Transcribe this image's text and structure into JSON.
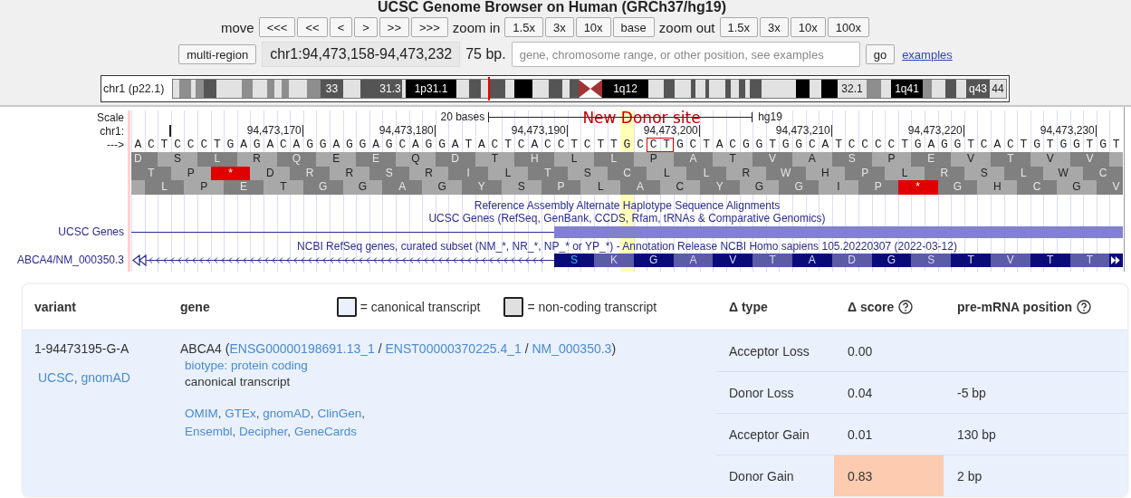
{
  "browser": {
    "title": "UCSC Genome Browser on Human (GRCh37/hg19)",
    "move": {
      "label": "move",
      "buttons": [
        "<<<",
        "<<",
        "<",
        ">",
        ">>",
        ">>>"
      ]
    },
    "zoom_in": {
      "label": "zoom in",
      "buttons": [
        "1.5x",
        "3x",
        "10x",
        "base"
      ]
    },
    "zoom_out": {
      "label": "zoom out",
      "buttons": [
        "1.5x",
        "3x",
        "10x",
        "100x"
      ]
    },
    "multi_region_button": "multi-region",
    "position": "chr1:94,473,158-94,473,232",
    "size": "75 bp.",
    "search": {
      "placeholder": "gene, chromosome range, or other position, see examples"
    },
    "go_button": "go",
    "examples_link": "examples",
    "ideogram": {
      "label": "chr1 (p22.1)",
      "band_labels": [
        "33",
        "31.3",
        "1p31.1",
        "1q12",
        "32.1",
        "1q41",
        "q43",
        "44"
      ]
    }
  },
  "tracks": {
    "scale": {
      "label": "Scale",
      "span": "20 bases",
      "assembly": "hg19"
    },
    "ruler": {
      "label": "chr1:",
      "ticks": [
        "94,473,170",
        "94,473,180",
        "94,473,190",
        "94,473,200",
        "94,473,210",
        "94,473,220",
        "94,473,230"
      ]
    },
    "strand": "--->",
    "annotation": "New Donor site",
    "sequence": [
      {
        "bases": "ACTCCCTGAGACAGGAGGAGCAGGATACTCACCTCTT",
        "kind": "plain"
      },
      {
        "bases": "G",
        "kind": "highlight"
      },
      {
        "bases": "C",
        "kind": "plain"
      },
      {
        "bases": "CT",
        "kind": "boxed"
      },
      {
        "bases": "GCTACGGTGGCATCCCCTGAGGTCACTGTGGTGT",
        "kind": "plain"
      }
    ],
    "frames": [
      {
        "residues": [
          {
            "aa": "D",
            "stop": false
          },
          {
            "aa": "S",
            "stop": false
          },
          {
            "aa": "L",
            "stop": false
          },
          {
            "aa": "R",
            "stop": false
          },
          {
            "aa": "Q",
            "stop": false
          },
          {
            "aa": "E",
            "stop": false
          },
          {
            "aa": "E",
            "stop": false
          },
          {
            "aa": "Q",
            "stop": false
          },
          {
            "aa": "D",
            "stop": false
          },
          {
            "aa": "T",
            "stop": false
          },
          {
            "aa": "H",
            "stop": false
          },
          {
            "aa": "L",
            "stop": false
          },
          {
            "aa": "L",
            "stop": false
          },
          {
            "aa": "P",
            "stop": false
          },
          {
            "aa": "A",
            "stop": false
          },
          {
            "aa": "T",
            "stop": false
          },
          {
            "aa": "V",
            "stop": false
          },
          {
            "aa": "A",
            "stop": false
          },
          {
            "aa": "S",
            "stop": false
          },
          {
            "aa": "P",
            "stop": false
          },
          {
            "aa": "E",
            "stop": false
          },
          {
            "aa": "V",
            "stop": false
          },
          {
            "aa": "T",
            "stop": false
          },
          {
            "aa": "V",
            "stop": false
          },
          {
            "aa": "V",
            "stop": false
          }
        ]
      },
      {
        "residues": [
          {
            "aa": "T",
            "stop": false
          },
          {
            "aa": "P",
            "stop": false
          },
          {
            "aa": "*",
            "stop": true
          },
          {
            "aa": "D",
            "stop": false
          },
          {
            "aa": "R",
            "stop": false
          },
          {
            "aa": "R",
            "stop": false
          },
          {
            "aa": "S",
            "stop": false
          },
          {
            "aa": "R",
            "stop": false
          },
          {
            "aa": "I",
            "stop": false
          },
          {
            "aa": "L",
            "stop": false
          },
          {
            "aa": "T",
            "stop": false
          },
          {
            "aa": "S",
            "stop": false
          },
          {
            "aa": "C",
            "stop": false
          },
          {
            "aa": "L",
            "stop": false
          },
          {
            "aa": "L",
            "stop": false
          },
          {
            "aa": "R",
            "stop": false
          },
          {
            "aa": "W",
            "stop": false
          },
          {
            "aa": "H",
            "stop": false
          },
          {
            "aa": "P",
            "stop": false
          },
          {
            "aa": "L",
            "stop": false
          },
          {
            "aa": "R",
            "stop": false
          },
          {
            "aa": "S",
            "stop": false
          },
          {
            "aa": "L",
            "stop": false
          },
          {
            "aa": "W",
            "stop": false
          },
          {
            "aa": "C",
            "stop": false
          }
        ]
      },
      {
        "residues": [
          {
            "aa": "L",
            "stop": false
          },
          {
            "aa": "P",
            "stop": false
          },
          {
            "aa": "E",
            "stop": false
          },
          {
            "aa": "T",
            "stop": false
          },
          {
            "aa": "G",
            "stop": false
          },
          {
            "aa": "G",
            "stop": false
          },
          {
            "aa": "A",
            "stop": false
          },
          {
            "aa": "G",
            "stop": false
          },
          {
            "aa": "Y",
            "stop": false
          },
          {
            "aa": "S",
            "stop": false
          },
          {
            "aa": "P",
            "stop": false
          },
          {
            "aa": "L",
            "stop": false
          },
          {
            "aa": "A",
            "stop": false
          },
          {
            "aa": "C",
            "stop": false
          },
          {
            "aa": "Y",
            "stop": false
          },
          {
            "aa": "G",
            "stop": false
          },
          {
            "aa": "G",
            "stop": false
          },
          {
            "aa": "I",
            "stop": false
          },
          {
            "aa": "P",
            "stop": false
          },
          {
            "aa": "*",
            "stop": true
          },
          {
            "aa": "G",
            "stop": false
          },
          {
            "aa": "H",
            "stop": false
          },
          {
            "aa": "C",
            "stop": false
          },
          {
            "aa": "G",
            "stop": false
          },
          {
            "aa": "V",
            "stop": false
          }
        ]
      }
    ],
    "headings": [
      "Reference Assembly Alternate Haplotype Sequence Alignments",
      "UCSC Genes (RefSeq, GenBank, CCDS, Rfam, tRNAs & Comparative Genomics)"
    ],
    "ucsc_genes": {
      "label": "UCSC Genes"
    },
    "refseq_heading": "NCBI RefSeq genes, curated subset (NM_*, NR_*, NP_* or YP_*) - Annotation Release NCBI Homo sapiens 105.20220307 (2022-03-12)",
    "refseq": {
      "label": "ABCA4/NM_000350.3",
      "codons": [
        "S",
        "K",
        "G",
        "A",
        "V",
        "T",
        "A",
        "D",
        "G",
        "S",
        "T",
        "V",
        "T",
        "T"
      ]
    }
  },
  "results": {
    "headers": {
      "variant": "variant",
      "gene": "gene",
      "type": "Δ type",
      "score": "Δ score",
      "position": "pre-mRNA position"
    },
    "legend": [
      {
        "label": "= canonical transcript",
        "kind": "canonical"
      },
      {
        "label": "= non-coding transcript",
        "kind": "noncoding"
      }
    ],
    "variant": {
      "id": "1-94473195-G-A",
      "links": [
        "UCSC",
        "gnomAD"
      ],
      "separator": ","
    },
    "gene": {
      "symbol": "ABCA4",
      "open": "(",
      "ids": [
        "ENSG00000198691.13_1",
        "ENST00000370225.4_1",
        "NM_000350.3"
      ],
      "id_separator": "/",
      "close": ")",
      "biotype": "biotype: protein coding",
      "transcript": "canonical transcript",
      "links": [
        "OMIM",
        "GTEx",
        "gnomAD",
        "ClinGen",
        "Ensembl",
        "Decipher",
        "GeneCards"
      ],
      "separator": ","
    },
    "rows": [
      {
        "type": "Acceptor Loss",
        "score": "0.00",
        "highlighted": false
      },
      {
        "type": "Donor Loss",
        "score": "0.04",
        "position": "-5 bp",
        "highlighted": false
      },
      {
        "type": "Acceptor Gain",
        "score": "0.01",
        "position": "130 bp",
        "highlighted": false
      },
      {
        "type": "Donor Gain",
        "score": "0.83",
        "position": "2 bp",
        "highlighted": true
      }
    ]
  }
}
